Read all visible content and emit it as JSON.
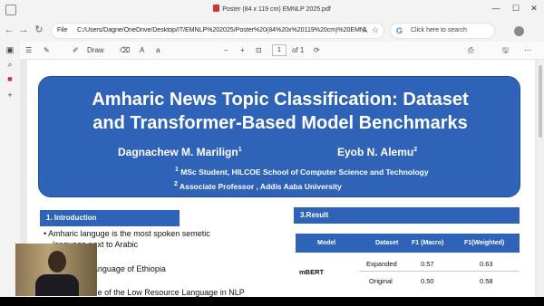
{
  "window": {
    "title": "Poster (84 x 119 cm) EMNLP 2025.pdf",
    "minimize": "—",
    "maximize": "☐",
    "close": "✕"
  },
  "address": {
    "back": "←",
    "forward": "→",
    "refresh": "↻",
    "file_label": "File",
    "url": "C:/Users/Dagne/OneDrive/Desktop/IT/EMNLP%202025/Poster%20(84%20x%20119%20cm)%20EMNLP%2...",
    "read_aloud": "A",
    "favorite": "☆",
    "search_placeholder": "Click here to search"
  },
  "pdf_toolbar": {
    "contents": "☰",
    "highlight": "✎",
    "draw_label": "Draw",
    "erase": "⌫",
    "read": "A",
    "translate": "a",
    "zoom_out": "−",
    "zoom_in": "+",
    "fit": "⊡",
    "page_current": "1",
    "page_total": "of 1",
    "rotate": "⟳",
    "print": "⎙",
    "save": "🖫",
    "more": "⋯"
  },
  "sidebar": {
    "tabs_icon": "▣",
    "search_icon": "⌕",
    "pdf_icon": "■",
    "add_icon": "+"
  },
  "poster": {
    "title_line1": "Amharic News Topic Classification: Dataset",
    "title_line2": "and Transformer-Based Model Benchmarks",
    "author1": "Dagnachew M. Marilign",
    "author1_sup": "1",
    "author2": "Eyob N. Alemu",
    "author2_sup": "2",
    "aff1_sup": "1",
    "aff1": "MSc Student, HILCOE  School of Computer Science and Technology",
    "aff2_sup": "2",
    "aff2": "Associate Professor , Addis Aaba University",
    "intro_header": "1. Introduction",
    "result_header": "3.Result",
    "bullet1a": "Amharic  languge     is  the  most  spoken  semetic",
    "bullet1b": "language next to Arabic",
    "bullet2": "the official language of Ethiopia",
    "bullet3": "Amharic is one of the Low Resource Language in NLP"
  },
  "results_table": {
    "headers": [
      "Model",
      "Dataset",
      "F1 (Macro)",
      "F1(Weighted)"
    ],
    "model": "mBERT",
    "rows": [
      {
        "dataset": "Expanded",
        "f1_macro": "0.57",
        "f1_weighted": "0.63"
      },
      {
        "dataset": "Original",
        "f1_macro": "0.50",
        "f1_weighted": "0.58"
      }
    ]
  }
}
